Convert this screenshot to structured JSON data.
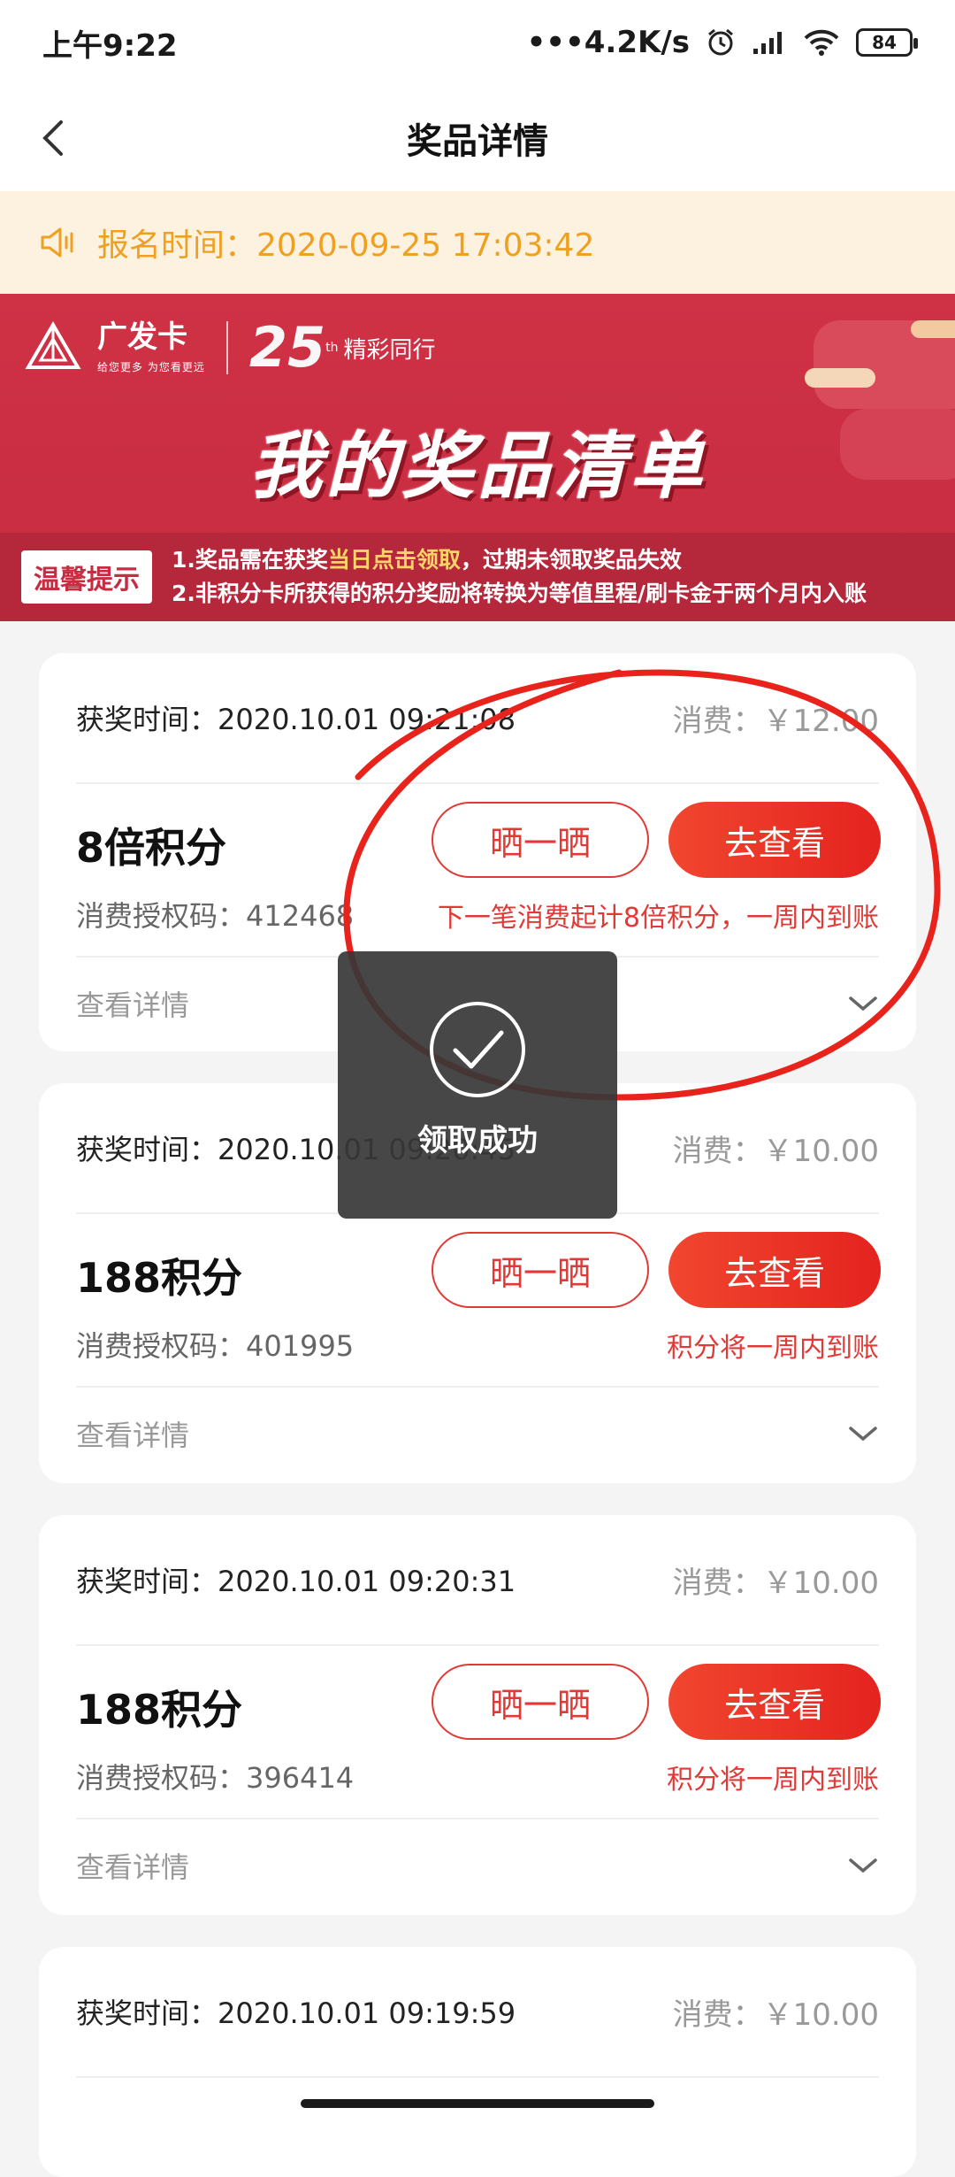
{
  "status_bar": {
    "time": "上午9:22",
    "network_speed": "•••4.2K/s",
    "battery": "84",
    "icons": [
      "alarm-icon",
      "signal-icon",
      "wifi-icon",
      "battery-icon"
    ]
  },
  "header": {
    "title": "奖品详情",
    "back_icon": "chevron-left-icon"
  },
  "notice": {
    "icon": "speaker-icon",
    "text": "报名时间：2020-09-25 17:03:42"
  },
  "banner": {
    "brand": "广发卡",
    "brand_slogan": "给您更多 为您看更远",
    "anniversary_number": "25",
    "anniversary_suffix": "th",
    "anniversary_text": "精彩同行",
    "title": "我的奖品清单",
    "tips_badge": "温馨提示",
    "tip1_prefix": "1.奖品需在获奖",
    "tip1_highlight": "当日点击领取",
    "tip1_suffix": "，过期未领取奖品失效",
    "tip2": "2.非积分卡所获得的积分奖励将转换为等值里程/刷卡金于两个月内入账"
  },
  "cards": [
    {
      "award_time": "获奖时间：2020.10.01 09:21:08",
      "spend": "消费：￥12.00",
      "prize": "8倍积分",
      "auth_code": "消费授权码：412468",
      "share_label": "晒一晒",
      "view_label": "去查看",
      "note": "下一笔消费起计8倍积分，一周内到账",
      "detail_label": "查看详情"
    },
    {
      "award_time": "获奖时间：2020.10.01 09:20:45",
      "spend": "消费：￥10.00",
      "prize": "188积分",
      "auth_code": "消费授权码：401995",
      "share_label": "晒一晒",
      "view_label": "去查看",
      "note": "积分将一周内到账",
      "detail_label": "查看详情"
    },
    {
      "award_time": "获奖时间：2020.10.01 09:20:31",
      "spend": "消费：￥10.00",
      "prize": "188积分",
      "auth_code": "消费授权码：396414",
      "share_label": "晒一晒",
      "view_label": "去查看",
      "note": "积分将一周内到账",
      "detail_label": "查看详情"
    },
    {
      "award_time": "获奖时间：2020.10.01 09:19:59",
      "spend": "消费：￥10.00"
    }
  ],
  "toast": {
    "icon": "check-circle-icon",
    "text": "领取成功"
  },
  "colors": {
    "accent_red": "#e03a36",
    "banner_red": "#c72c40",
    "notice_bg": "#fdf1e0",
    "notice_text": "#f0a020"
  }
}
